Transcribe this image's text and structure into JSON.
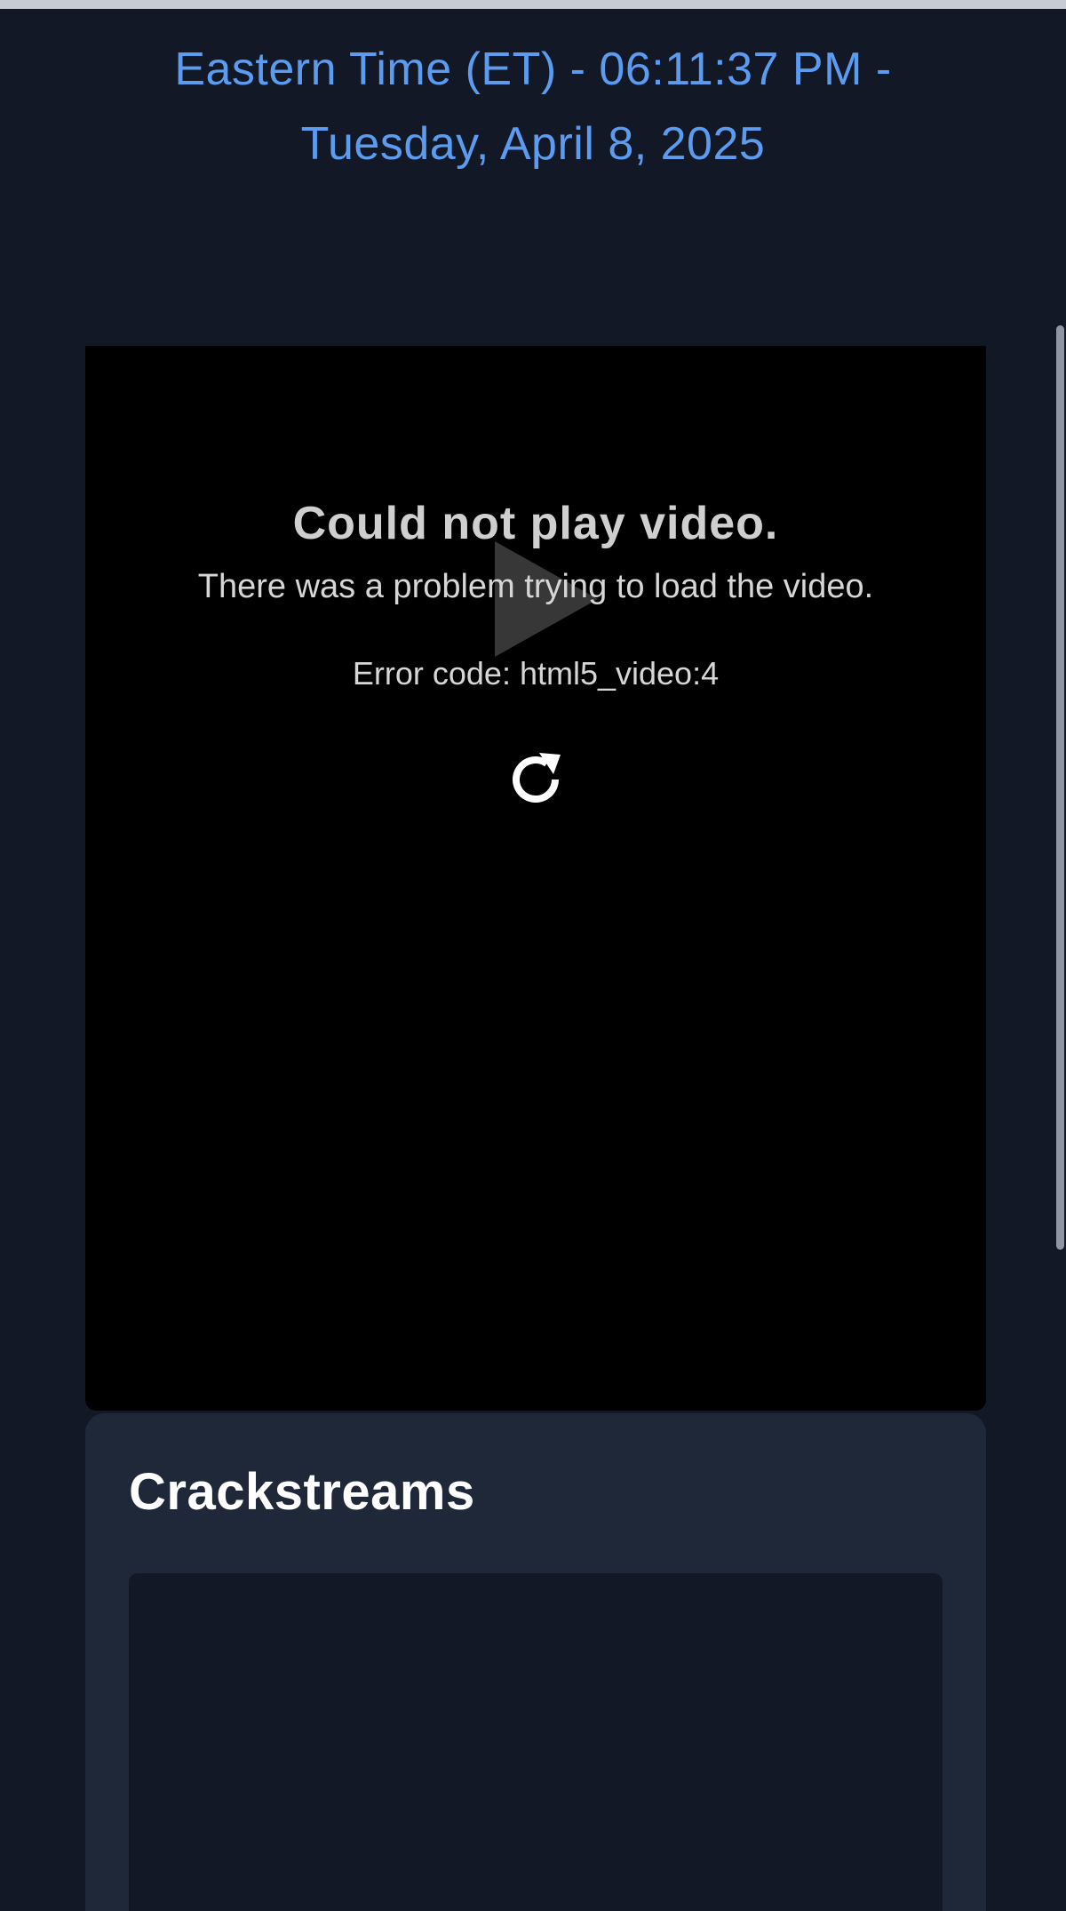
{
  "header": {
    "time_line_1": "Eastern Time (ET) - 06:11:37 PM -",
    "time_line_2": "Tuesday, April 8, 2025"
  },
  "video_player": {
    "error_title": "Could not play video.",
    "error_message": "There was a problem trying to load the video.",
    "error_code": "Error code: html5_video:4",
    "icons": [
      "play-icon",
      "reload-icon"
    ]
  },
  "card": {
    "title": "Crackstreams"
  },
  "colors": {
    "background": "#121826",
    "card": "#1f2838",
    "header_text": "#5b9cf0",
    "player": "#000000"
  }
}
